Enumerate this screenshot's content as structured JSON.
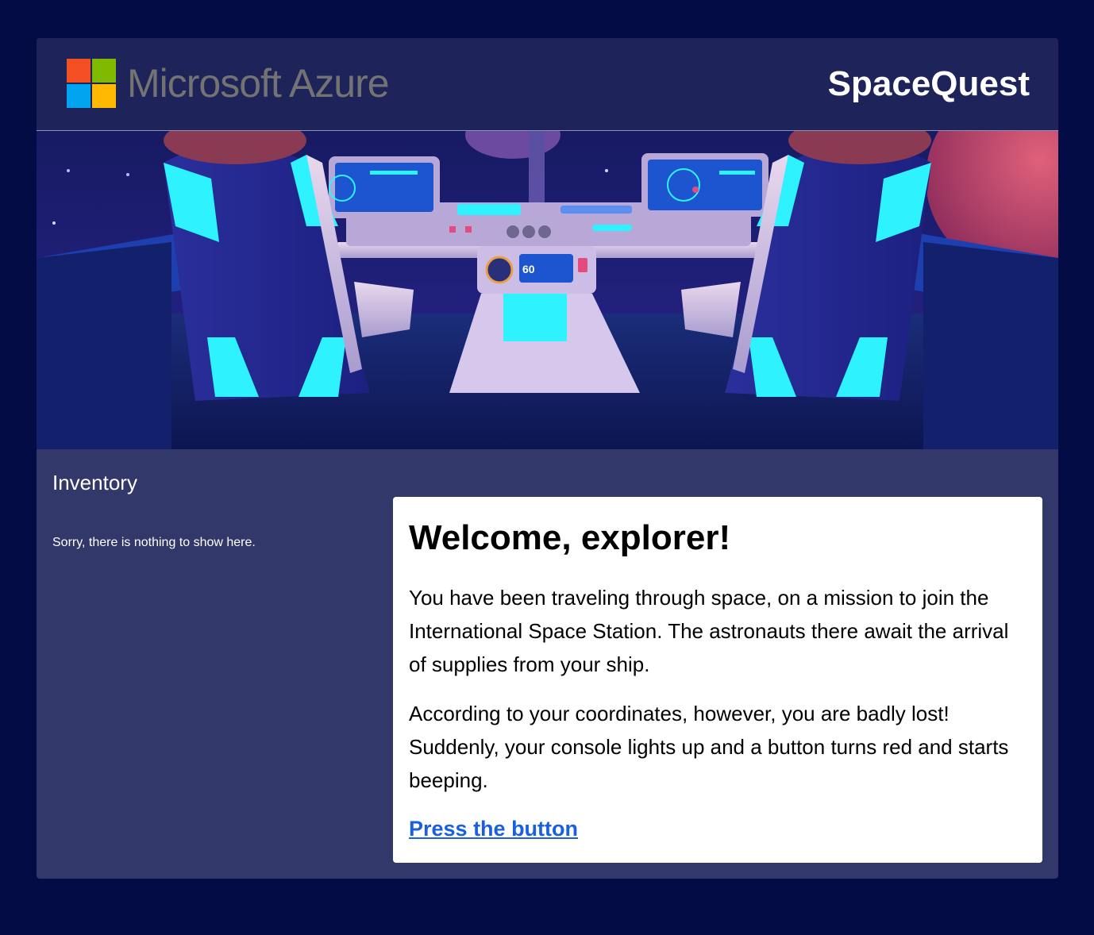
{
  "header": {
    "brand": "Microsoft Azure",
    "app_title": "SpaceQuest",
    "logo_colors": [
      "#f25022",
      "#7fba00",
      "#00a4ef",
      "#ffb900"
    ]
  },
  "hero": {
    "description_icon": "spaceship-cockpit-illustration",
    "speed_readout": "60"
  },
  "inventory": {
    "title": "Inventory",
    "empty_message": "Sorry, there is nothing to show here."
  },
  "story": {
    "title": "Welcome, explorer!",
    "paragraphs": [
      "You have been traveling through space, on a mission to join the International Space Station. The astronauts there await the arrival of supplies from your ship.",
      "According to your coordinates, however, you are badly lost! Suddenly, your console lights up and a button turns red and starts beeping."
    ],
    "action_link": "Press the button"
  },
  "colors": {
    "page_bg": "#030c45",
    "panel_bg": "#33386b",
    "header_bg": "#1e2359",
    "link": "#1a5fe0",
    "accent_glow": "#2ef3ff"
  }
}
